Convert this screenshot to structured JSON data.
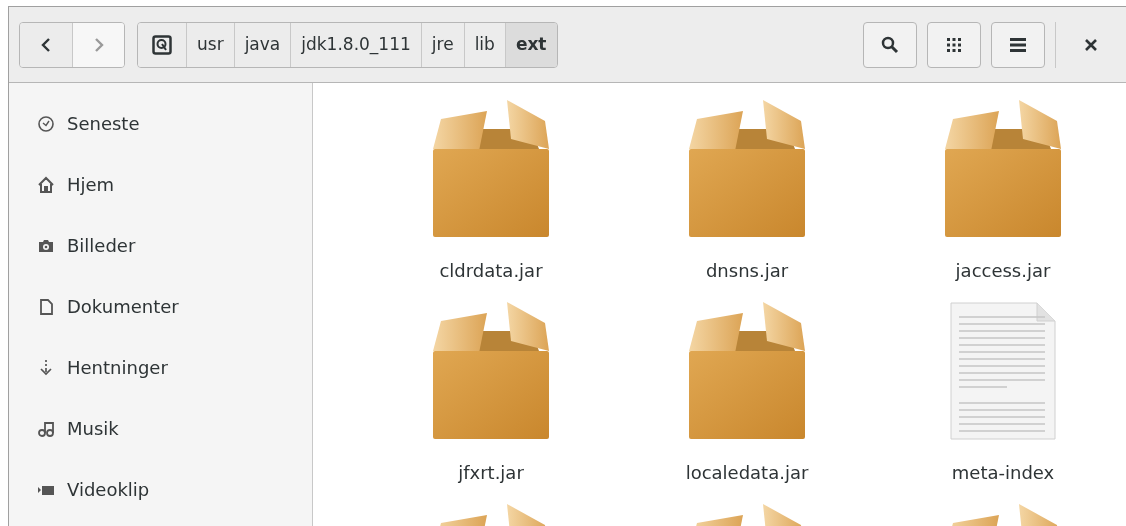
{
  "navigation": {
    "back": {
      "disabled": false
    },
    "forward": {
      "disabled": true
    }
  },
  "breadcrumbs": [
    {
      "kind": "drive",
      "selected": false
    },
    {
      "label": "usr",
      "selected": false
    },
    {
      "label": "java",
      "selected": false
    },
    {
      "label": "jdk1.8.0_111",
      "selected": false
    },
    {
      "label": "jre",
      "selected": false
    },
    {
      "label": "lib",
      "selected": false
    },
    {
      "label": "ext",
      "selected": true
    }
  ],
  "sidebar": {
    "items": [
      {
        "kind": "clock",
        "label": "Seneste"
      },
      {
        "kind": "home",
        "label": "Hjem"
      },
      {
        "kind": "camera",
        "label": "Billeder"
      },
      {
        "kind": "document",
        "label": "Dokumenter"
      },
      {
        "kind": "download",
        "label": "Hentninger"
      },
      {
        "kind": "music",
        "label": "Musik"
      },
      {
        "kind": "video",
        "label": "Videoklip"
      }
    ]
  },
  "files": [
    {
      "kind": "package",
      "name": "cldrdata.jar"
    },
    {
      "kind": "package",
      "name": "dnsns.jar"
    },
    {
      "kind": "package",
      "name": "jaccess.jar"
    },
    {
      "kind": "package",
      "name": "jfxrt.jar"
    },
    {
      "kind": "package",
      "name": "localedata.jar"
    },
    {
      "kind": "text",
      "name": "meta-index"
    },
    {
      "kind": "package"
    },
    {
      "kind": "package"
    },
    {
      "kind": "package"
    }
  ]
}
